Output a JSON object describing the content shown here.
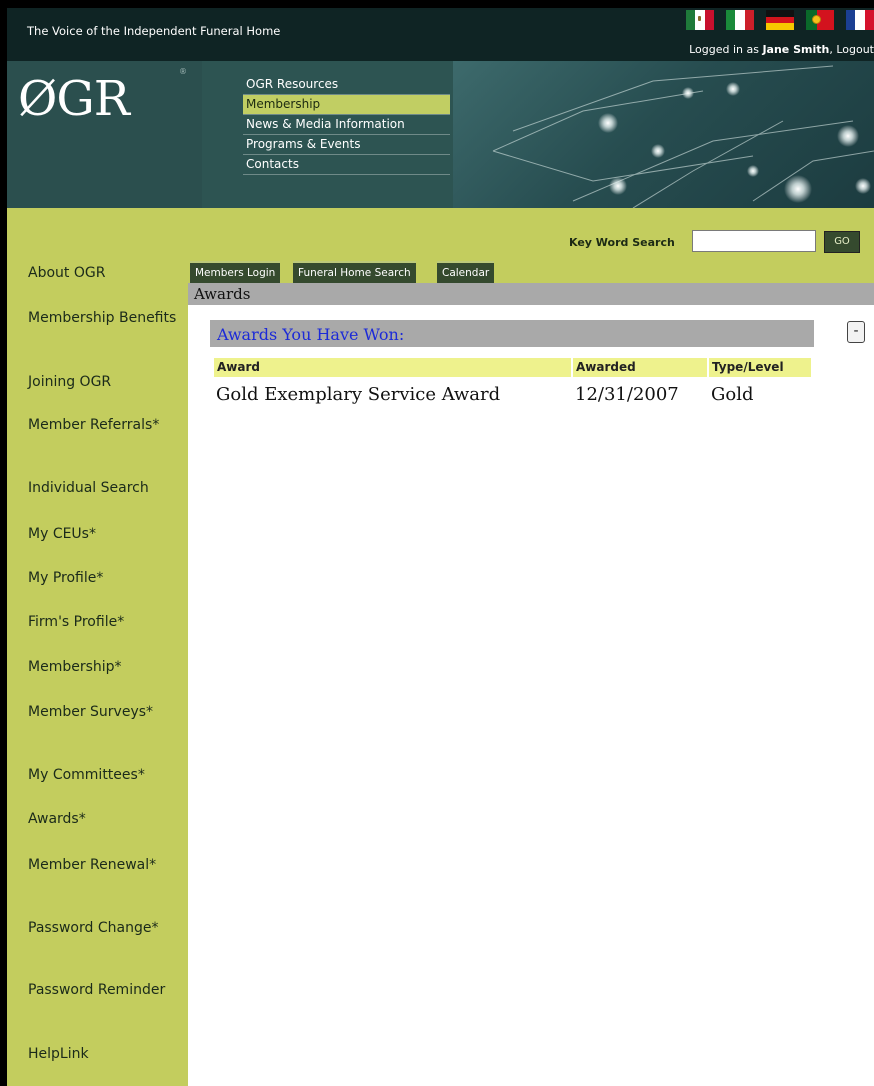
{
  "header": {
    "tagline": "The Voice of the Independent Funeral Home",
    "logged_in_prefix": "Logged in as ",
    "user_name": "Jane Smith",
    "logout_suffix": ", Logout",
    "flags": [
      "mexico-flag-icon",
      "italy-flag-icon",
      "germany-flag-icon",
      "portugal-flag-icon",
      "france-flag-icon"
    ]
  },
  "banner": {
    "logo": "ØGR",
    "logo_mark": "®",
    "nav": [
      {
        "label": "OGR Resources"
      },
      {
        "label": "Membership"
      },
      {
        "label": "News & Media Information"
      },
      {
        "label": "Programs & Events"
      },
      {
        "label": "Contacts"
      }
    ]
  },
  "search": {
    "label": "Key Word Search",
    "value": "",
    "button": "GO"
  },
  "tabs": [
    {
      "label": "Members Login"
    },
    {
      "label": "Funeral Home Search"
    },
    {
      "label": "Calendar"
    }
  ],
  "sidebar": {
    "items": [
      {
        "label": "About OGR"
      },
      {
        "label": "Membership Benefits"
      },
      {
        "label": "Joining OGR"
      },
      {
        "label": "Member Referrals*"
      },
      {
        "label": "Individual Search"
      },
      {
        "label": "My CEUs*"
      },
      {
        "label": "My Profile*"
      },
      {
        "label": "Firm's Profile*"
      },
      {
        "label": "Membership*"
      },
      {
        "label": "Member Surveys*"
      },
      {
        "label": "My Committees*"
      },
      {
        "label": "Awards*"
      },
      {
        "label": "Member Renewal*"
      },
      {
        "label": "Password Change*"
      },
      {
        "label": "Password Reminder"
      },
      {
        "label": "HelpLink"
      }
    ]
  },
  "content": {
    "section_title": "Awards",
    "awards_heading": "Awards You Have Won:",
    "collapse_label": "-",
    "table": {
      "headers": [
        "Award",
        "Awarded",
        "Type/Level"
      ],
      "rows": [
        [
          "Gold Exemplary Service Award",
          "12/31/2007",
          "Gold"
        ]
      ]
    }
  },
  "colors": {
    "topbar": "#0f2424",
    "banner": "#2d5452",
    "sidebar": "#c3cd5e",
    "tab": "#354a2e",
    "section_bar": "#a9a9a9",
    "awards_heading": "#1c2ad8",
    "table_header": "#eef28d"
  }
}
